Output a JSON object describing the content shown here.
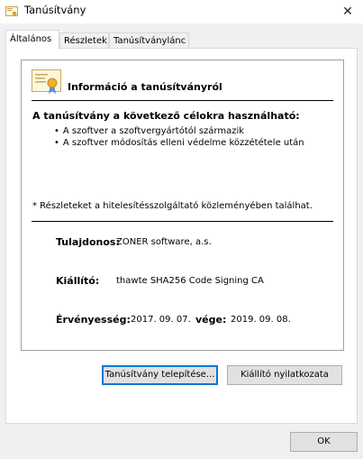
{
  "window": {
    "title": "Tanúsítvány",
    "close_glyph": "✕"
  },
  "tabs": [
    {
      "label": "Általános"
    },
    {
      "label": "Részletek"
    },
    {
      "label": "Tanúsítványlánc"
    }
  ],
  "info": {
    "header": "Információ a tanúsítványról",
    "purpose_title": "A tanúsítvány a következő célokra használható:",
    "purposes": [
      "A szoftver a szoftvergyártótól származik",
      "A szoftver módosítás elleni védelme közzététele után"
    ],
    "note": "* Részleteket a hitelesítésszolgáltató közleményében találhat.",
    "owner_label": "Tulajdonos:",
    "owner_value": "ZONER software, a.s.",
    "issuer_label": "Kiállító:",
    "issuer_value": "thawte SHA256 Code Signing CA",
    "validity_label": "Érvényesség:",
    "valid_from": "2017. 09. 07.",
    "valid_to_label": "vége:",
    "valid_to": "2019. 09. 08."
  },
  "buttons": {
    "install": "Tanúsítvány telepítése...",
    "issuer_statement": "Kiállító nyilatkozata",
    "ok": "OK"
  },
  "icons": {
    "title_icon": "certificate-icon",
    "info_icon": "certificate-ribbon-icon"
  }
}
